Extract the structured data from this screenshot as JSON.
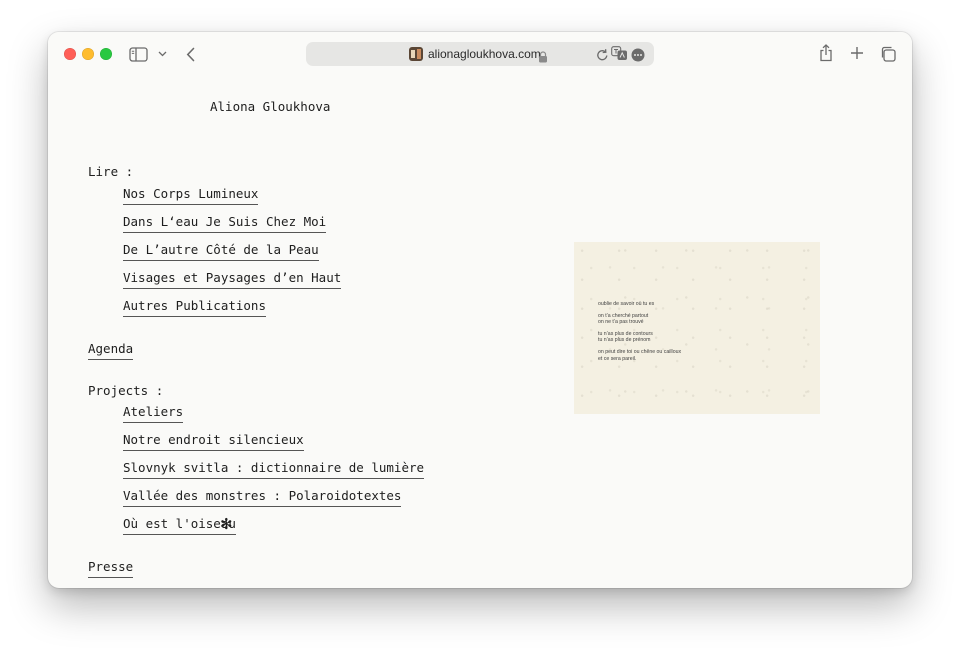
{
  "browser": {
    "url": "alionagloukhova.com"
  },
  "site": {
    "title": "Aliona Gloukhova"
  },
  "nav": {
    "lire_label": "Lire :",
    "lire_items": [
      "Nos Corps Lumineux",
      "Dans L‘eau Je Suis Chez Moi",
      "De L’autre Côté de la Peau",
      "Visages et Paysages d’en Haut",
      "Autres Publications"
    ],
    "agenda": "Agenda",
    "projects_label": "Projects :",
    "projects_items": [
      "Ateliers",
      "Notre endroit silencieux",
      "Slovnyk svitla : dictionnaire de lumière",
      "Vallée des monstres : Polaroidotextes",
      "Où est l'oiseau"
    ],
    "projects_last_suffix": "✻",
    "presse": "Presse"
  },
  "poem": {
    "lines": [
      "oublie de savoir où tu es",
      "",
      "on t’a cherché partout",
      "on ne t’a pas trouvé",
      "",
      "tu n’as plus de contours",
      "tu n’as plus de prénom",
      "",
      "on peut dire toi ou chêne ou cailloux",
      "et ce sera pareil."
    ]
  },
  "icons": {
    "sidebar": "sidebar-icon",
    "back": "chevron-left-icon",
    "share": "share-icon",
    "new_tab": "plus-icon",
    "tabs": "tab-overview-icon",
    "lock": "lock-icon",
    "reload": "reload-icon",
    "translate": "translate-icon",
    "more": "more-icon"
  },
  "colors": {
    "close": "#ff5f57",
    "minimize": "#febc2e",
    "maximize": "#28c840",
    "page_bg": "#fafaf8",
    "card_bg": "#f4f0e2"
  }
}
